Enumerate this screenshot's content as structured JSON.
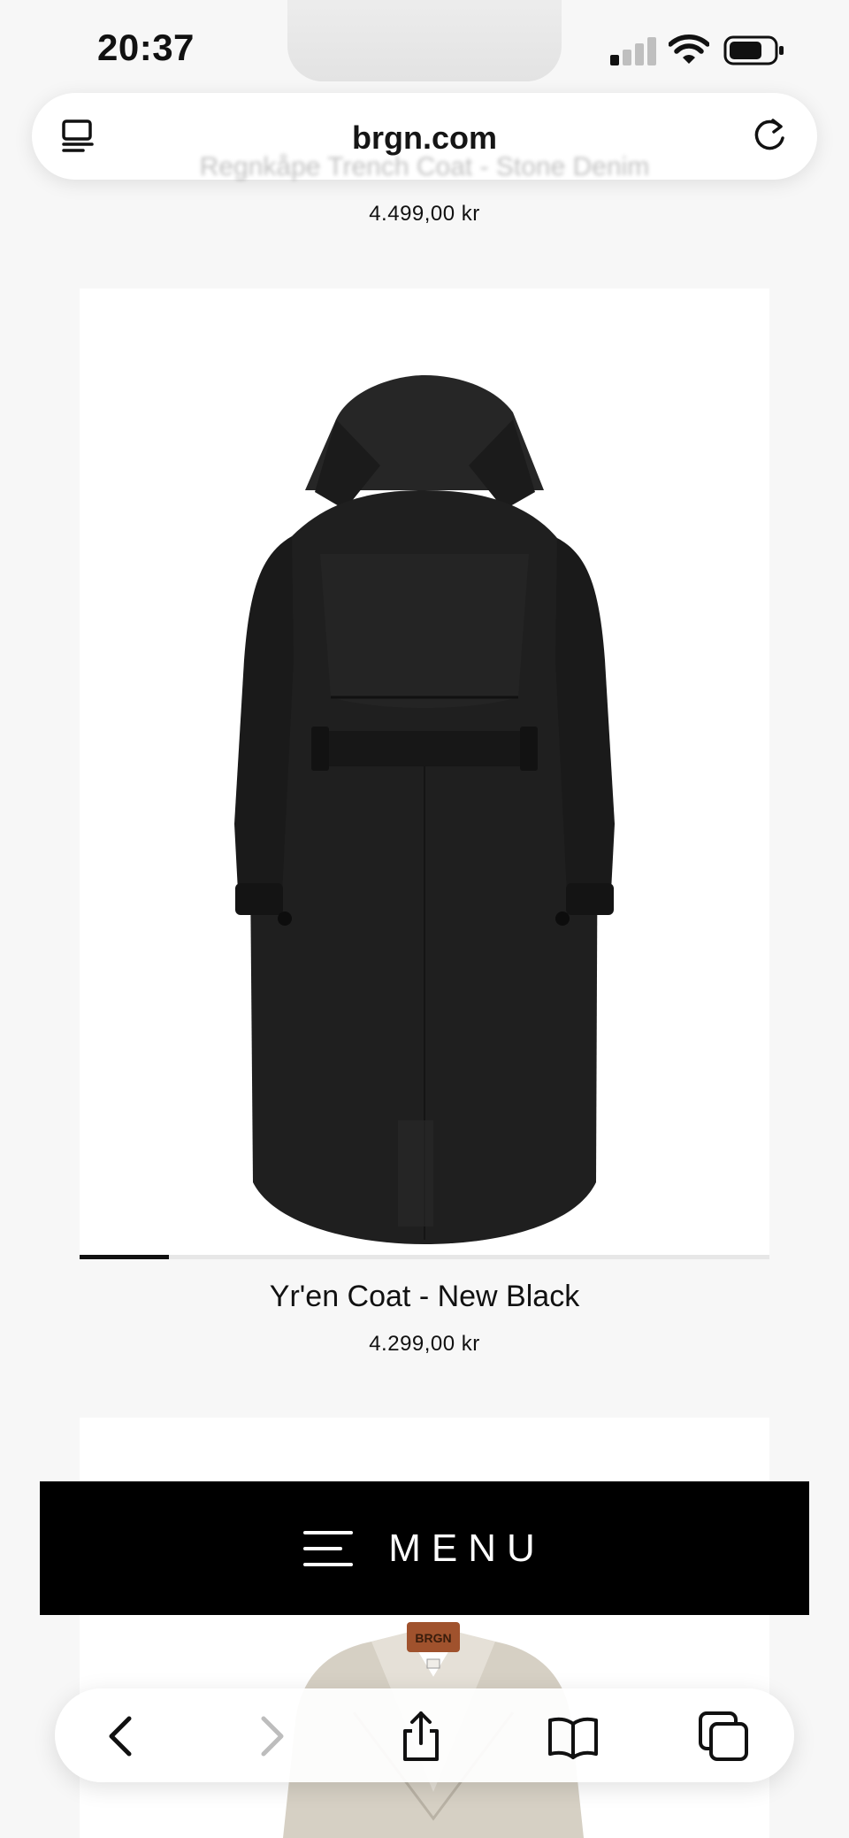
{
  "status_bar": {
    "time": "20:37"
  },
  "browser": {
    "url": "brgn.com"
  },
  "previous_product": {
    "title": "Regnkåpe Trench Coat - Stone Denim",
    "price": "4.499,00 kr"
  },
  "product": {
    "title": "Yr'en Coat - New Black",
    "price": "4.299,00 kr",
    "image_progress": 0.13
  },
  "menu": {
    "label": "MENU"
  },
  "icons": {
    "tabs_overview": "sidebar-icon",
    "reload": "reload-icon",
    "back": "chevron-left-icon",
    "forward": "chevron-right-icon",
    "share": "share-icon",
    "bookmarks": "book-icon",
    "tabs": "tabs-icon",
    "menu": "hamburger-icon"
  },
  "colors": {
    "page_background": "#f7f7f7",
    "menu_background": "#000000",
    "menu_text": "#ffffff",
    "coat": "#1e1e1e"
  }
}
